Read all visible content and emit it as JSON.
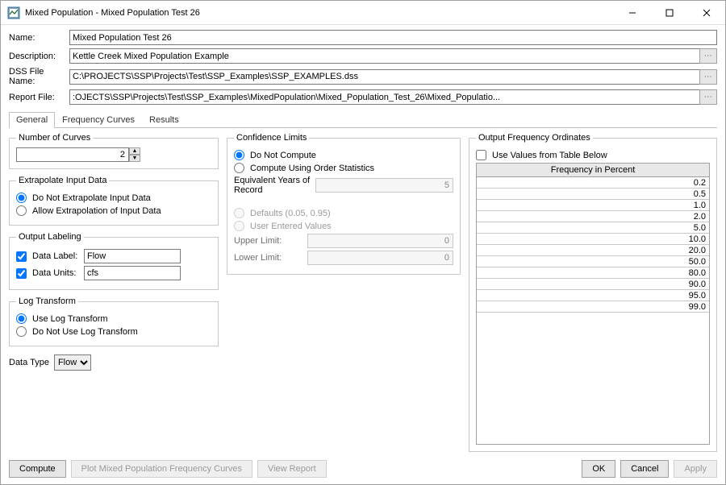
{
  "title": "Mixed Population - Mixed Population Test 26",
  "fields": {
    "name_label": "Name:",
    "name_value": "Mixed Population Test 26",
    "description_label": "Description:",
    "description_value": "Kettle Creek Mixed Population Example",
    "dssfile_label": "DSS File Name:",
    "dssfile_value": "C:\\PROJECTS\\SSP\\Projects\\Test\\SSP_Examples\\SSP_EXAMPLES.dss",
    "reportfile_label": "Report File:",
    "reportfile_value": ":OJECTS\\SSP\\Projects\\Test\\SSP_Examples\\MixedPopulation\\Mixed_Population_Test_26\\Mixed_Populatio..."
  },
  "tabs": {
    "general": "General",
    "freq_curves": "Frequency Curves",
    "results": "Results"
  },
  "general": {
    "num_curves_legend": "Number of Curves",
    "num_curves_value": "2",
    "extrapolate_legend": "Extrapolate Input Data",
    "extrapolate_no": "Do Not Extrapolate Input Data",
    "extrapolate_yes": "Allow Extrapolation of Input Data",
    "output_labeling_legend": "Output Labeling",
    "data_label_label": "Data Label:",
    "data_label_value": "Flow",
    "data_units_label": "Data Units:",
    "data_units_value": "cfs",
    "log_transform_legend": "Log Transform",
    "log_use": "Use Log Transform",
    "log_no": "Do Not Use Log Transform",
    "data_type_label": "Data Type",
    "data_type_value": "Flow"
  },
  "confidence": {
    "legend": "Confidence Limits",
    "do_not_compute": "Do Not Compute",
    "order_stats": "Compute Using Order Statistics",
    "eq_years_label": "Equivalent Years of Record",
    "eq_years_value": "5",
    "defaults": "Defaults (0.05, 0.95)",
    "user_entered": "User Entered Values",
    "upper_label": "Upper Limit:",
    "upper_value": "0",
    "lower_label": "Lower Limit:",
    "lower_value": "0"
  },
  "ordinates": {
    "legend": "Output Frequency Ordinates",
    "use_values": "Use Values from Table Below",
    "header": "Frequency in Percent",
    "values": [
      "0.2",
      "0.5",
      "1.0",
      "2.0",
      "5.0",
      "10.0",
      "20.0",
      "50.0",
      "80.0",
      "90.0",
      "95.0",
      "99.0"
    ]
  },
  "footer": {
    "compute": "Compute",
    "plot": "Plot Mixed Population Frequency Curves",
    "view_report": "View Report",
    "ok": "OK",
    "cancel": "Cancel",
    "apply": "Apply"
  }
}
